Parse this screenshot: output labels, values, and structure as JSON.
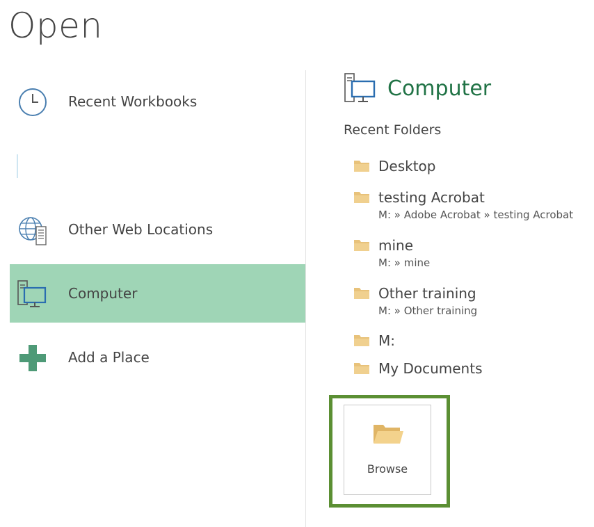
{
  "page": {
    "title": "Open"
  },
  "places": [
    {
      "label": "Recent Workbooks",
      "icon": "clock-icon",
      "selected": false
    },
    {
      "label": "Other Web Locations",
      "icon": "globe-server-icon",
      "selected": false
    },
    {
      "label": "Computer",
      "icon": "computer-icon",
      "selected": true
    },
    {
      "label": "Add a Place",
      "icon": "plus-icon",
      "selected": false
    }
  ],
  "computer_pane": {
    "title": "Computer",
    "recent_folders_label": "Recent Folders",
    "folders": [
      {
        "name": "Desktop",
        "path": ""
      },
      {
        "name": "testing Acrobat",
        "path": "M: » Adobe Acrobat » testing Acrobat"
      },
      {
        "name": "mine",
        "path": "M: » mine"
      },
      {
        "name": "Other training",
        "path": "M: » Other training"
      },
      {
        "name": "M:",
        "path": ""
      },
      {
        "name": "My Documents",
        "path": ""
      }
    ],
    "browse_label": "Browse"
  },
  "colors": {
    "accent_green": "#217346",
    "selected_bg": "#9fd5b6",
    "highlight_border": "#5b8f33",
    "folder_yellow": "#e8c27a"
  }
}
